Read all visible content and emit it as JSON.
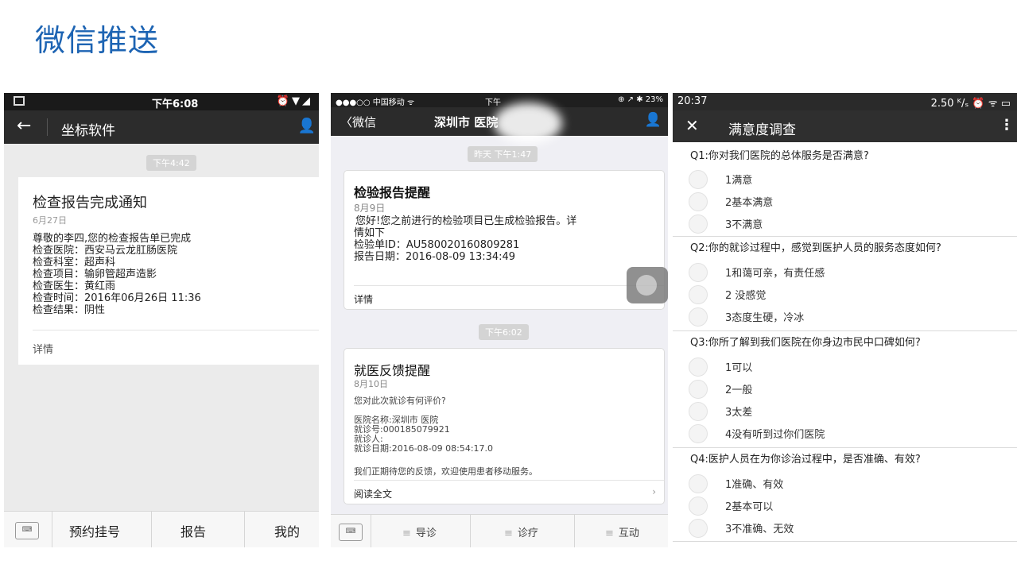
{
  "slide_title": "微信推送",
  "phone1": {
    "status_time": "下午6:08",
    "nav_title": "坐标软件",
    "timestamp": "下午4:42",
    "card": {
      "title": "检查报告完成通知",
      "date": "6月27日",
      "lines": [
        "尊敬的李四,您的检查报告单已完成",
        "检查医院：西安马云龙肛肠医院",
        "检查科室：超声科",
        "检查项目：输卵管超声造影",
        "检查医生：黄红雨",
        "检查时间：2016年06月26日 11:36",
        "检查结果：阴性"
      ],
      "more": "详情"
    },
    "tabs": [
      "预约挂号",
      "报告",
      "我的"
    ]
  },
  "phone2": {
    "status_left": "●●●○○ 中国移动 ᯤ",
    "status_center": "下午",
    "status_right": "⊕ ↗ ✱ 23%",
    "nav_back": "〈微信",
    "nav_title": "深圳市              医院",
    "timestamp1": "昨天 下午1:47",
    "card1": {
      "title": "检验报告提醒",
      "date": "8月9日",
      "lines": [
        "您好!您之前进行的检验项目已生成检验报告。详",
        "情如下",
        "检验单ID：AU580020160809281",
        "报告日期：2016-08-09 13:34:49"
      ],
      "more": "详情"
    },
    "timestamp2": "下午6:02",
    "card2": {
      "title": "就医反馈提醒",
      "date": "8月10日",
      "question": "您对此次就诊有何评价?",
      "lines": [
        "医院名称:深圳市          医院",
        "就诊号:000185079921",
        "就诊人:",
        "就诊日期:2016-08-09 08:54:17.0"
      ],
      "footer": "我们正期待您的反馈，欢迎使用患者移动服务。",
      "more": "阅读全文"
    },
    "tabs": [
      "导诊",
      "诊疗",
      "互动"
    ]
  },
  "phone3": {
    "status_time": "20:37",
    "status_right": "2.50 ᴷ/ₛ ⏰ ᯤ ▭",
    "nav_title": "满意度调查",
    "questions": [
      {
        "text": "Q1:你对我们医院的总体服务是否满意?",
        "options": [
          "1满意",
          "2基本满意",
          "3不满意"
        ]
      },
      {
        "text": "Q2:你的就诊过程中，感觉到医护人员的服务态度如何?",
        "options": [
          "1和蔼可亲，有责任感",
          "2 没感觉",
          "3态度生硬，冷冰"
        ]
      },
      {
        "text": "Q3:你所了解到我们医院在你身边市民中口碑如何?",
        "options": [
          "1可以",
          "2一般",
          "3太差",
          "4没有听到过你们医院"
        ]
      },
      {
        "text": "Q4:医护人员在为你诊治过程中，是否准确、有效?",
        "options": [
          "1准确、有效",
          "2基本可以",
          "3不准确、无效"
        ]
      }
    ]
  }
}
